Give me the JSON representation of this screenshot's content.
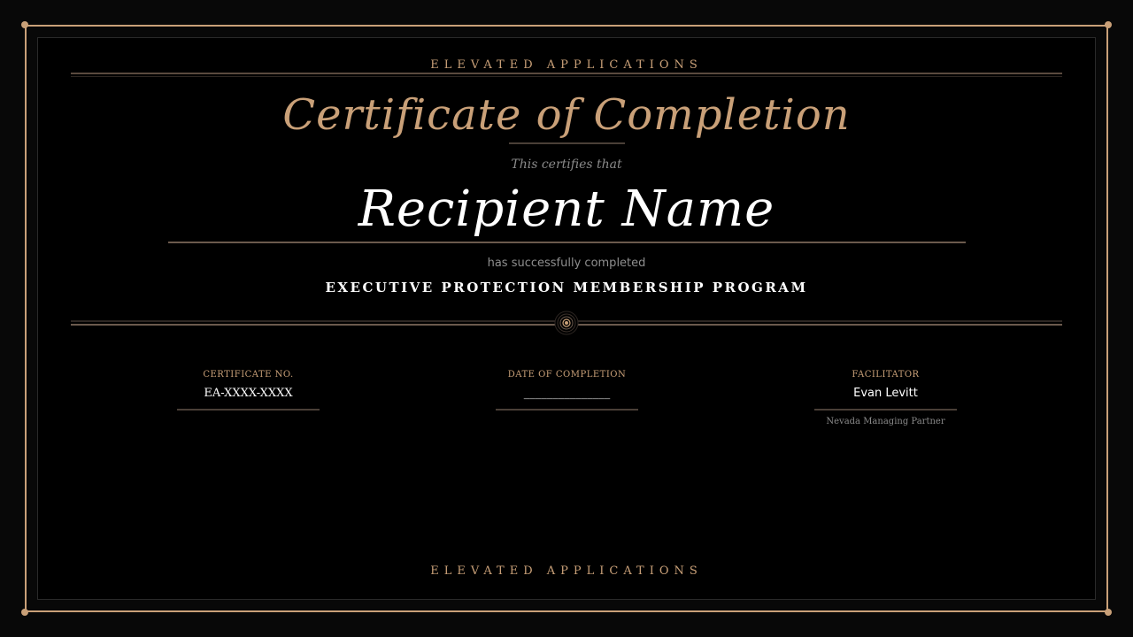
{
  "certificate": {
    "brand_top": "ELEVATED APPLICATIONS",
    "title": "Certificate of Completion",
    "certifies_text": "This certifies that",
    "recipient_name": "Recipient Name",
    "completed_text": "has successfully completed",
    "program_name": "EXECUTIVE PROTECTION MEMBERSHIP PROGRAM",
    "brand_bottom": "ELEVATED APPLICATIONS"
  },
  "fields": {
    "certificate_no": {
      "label": "CERTIFICATE NO.",
      "value": "EA-XXXX-XXXX"
    },
    "date_of_completion": {
      "label": "DATE OF COMPLETION",
      "value": "_______________"
    },
    "facilitator": {
      "label": "FACILITATOR",
      "value": "Evan Levitt",
      "subtitle": "Nevada Managing Partner"
    }
  },
  "colors": {
    "accent": "#c9a078",
    "background": "#000000",
    "text_primary": "#ffffff",
    "text_muted": "#8a8a8a"
  },
  "icons": {
    "seal": "concentric-circle-seal-icon"
  }
}
